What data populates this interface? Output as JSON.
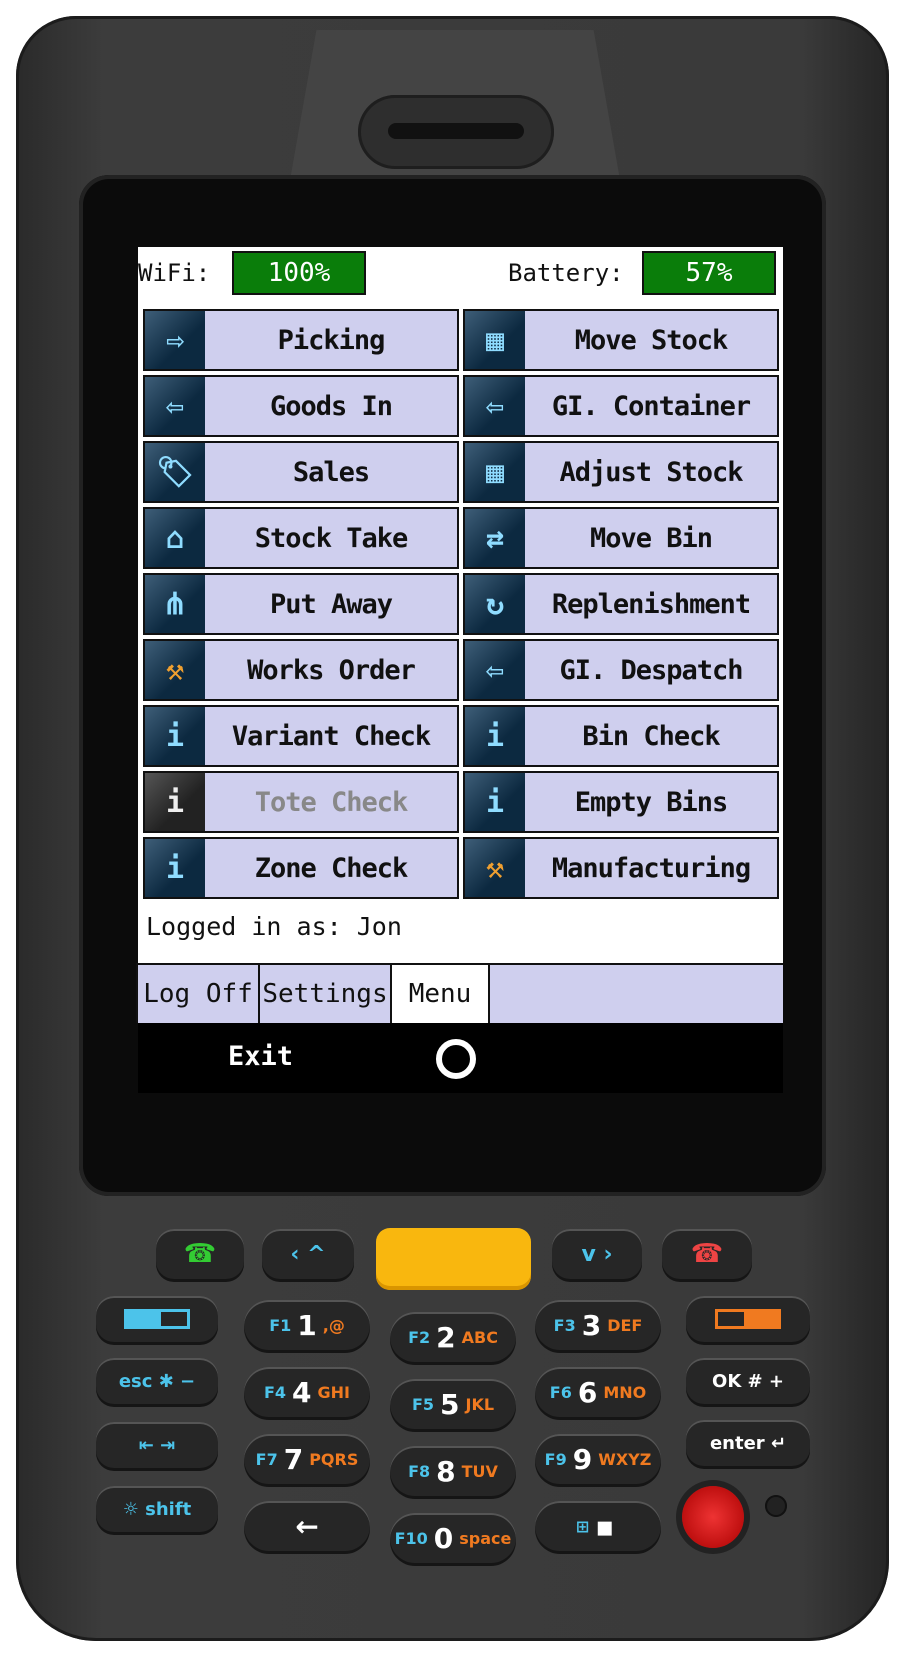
{
  "status": {
    "wifi_label": "WiFi:",
    "wifi_value": "100%",
    "battery_label": "Battery:",
    "battery_value": "57%",
    "wifi_percent": 100,
    "battery_percent": 57,
    "meter_color": "#0a7d0a"
  },
  "menu": [
    {
      "label": "Picking",
      "icon": "truck-right-icon",
      "glyph": "⇨"
    },
    {
      "label": "Move Stock",
      "icon": "move-boxes-icon",
      "glyph": "▦"
    },
    {
      "label": "Goods In",
      "icon": "truck-left-icon",
      "glyph": "⇦"
    },
    {
      "label": "GI. Container",
      "icon": "truck-left-icon",
      "glyph": "⇦"
    },
    {
      "label": "Sales",
      "icon": "price-tag-icon",
      "glyph": "🏷"
    },
    {
      "label": "Adjust Stock",
      "icon": "boxes-icon",
      "glyph": "▦"
    },
    {
      "label": "Stock Take",
      "icon": "house-check-icon",
      "glyph": "⌂"
    },
    {
      "label": "Move Bin",
      "icon": "swap-arrows-icon",
      "glyph": "⇄"
    },
    {
      "label": "Put Away",
      "icon": "hierarchy-icon",
      "glyph": "⋔"
    },
    {
      "label": "Replenishment",
      "icon": "cycle-boxes-icon",
      "glyph": "↻"
    },
    {
      "label": "Works Order",
      "icon": "hammer-icon",
      "glyph": "⚒"
    },
    {
      "label": "GI. Despatch",
      "icon": "truck-left-icon",
      "glyph": "⇦"
    },
    {
      "label": "Variant Check",
      "icon": "info-icon",
      "glyph": "i"
    },
    {
      "label": "Bin Check",
      "icon": "info-icon",
      "glyph": "i"
    },
    {
      "label": "Tote Check",
      "icon": "info-icon",
      "glyph": "i",
      "disabled": true
    },
    {
      "label": "Empty Bins",
      "icon": "info-icon",
      "glyph": "i"
    },
    {
      "label": "Zone Check",
      "icon": "info-icon",
      "glyph": "i"
    },
    {
      "label": "Manufacturing",
      "icon": "hammer-icon",
      "glyph": "⚒"
    }
  ],
  "logged_in": "Logged in as: Jon",
  "tabs": [
    {
      "label": "Log Off"
    },
    {
      "label": "Settings"
    },
    {
      "label": "Menu",
      "active": true
    }
  ],
  "command_bar": {
    "exit": "Exit"
  },
  "keypad": {
    "nav": {
      "up": "‹ ^",
      "down": "v ›"
    },
    "left": [
      "",
      "esc ✱ −",
      "⇤ ⇥",
      "☼ shift"
    ],
    "right": [
      "",
      "OK # +",
      "enter ↵"
    ],
    "numbers": [
      {
        "f": "F1",
        "n": "1",
        "a": ",@"
      },
      {
        "f": "F2",
        "n": "2",
        "a": "ABC"
      },
      {
        "f": "F3",
        "n": "3",
        "a": "DEF"
      },
      {
        "f": "F4",
        "n": "4",
        "a": "GHI"
      },
      {
        "f": "F5",
        "n": "5",
        "a": "JKL"
      },
      {
        "f": "F6",
        "n": "6",
        "a": "MNO"
      },
      {
        "f": "F7",
        "n": "7",
        "a": "PQRS"
      },
      {
        "f": "F8",
        "n": "8",
        "a": "TUV"
      },
      {
        "f": "F9",
        "n": "9",
        "a": "WXYZ"
      },
      {
        "f": "",
        "n": "←",
        "a": ""
      },
      {
        "f": "F10",
        "n": "0",
        "a": "space"
      },
      {
        "f": "⊞",
        "n": "▪",
        "a": ""
      }
    ]
  }
}
